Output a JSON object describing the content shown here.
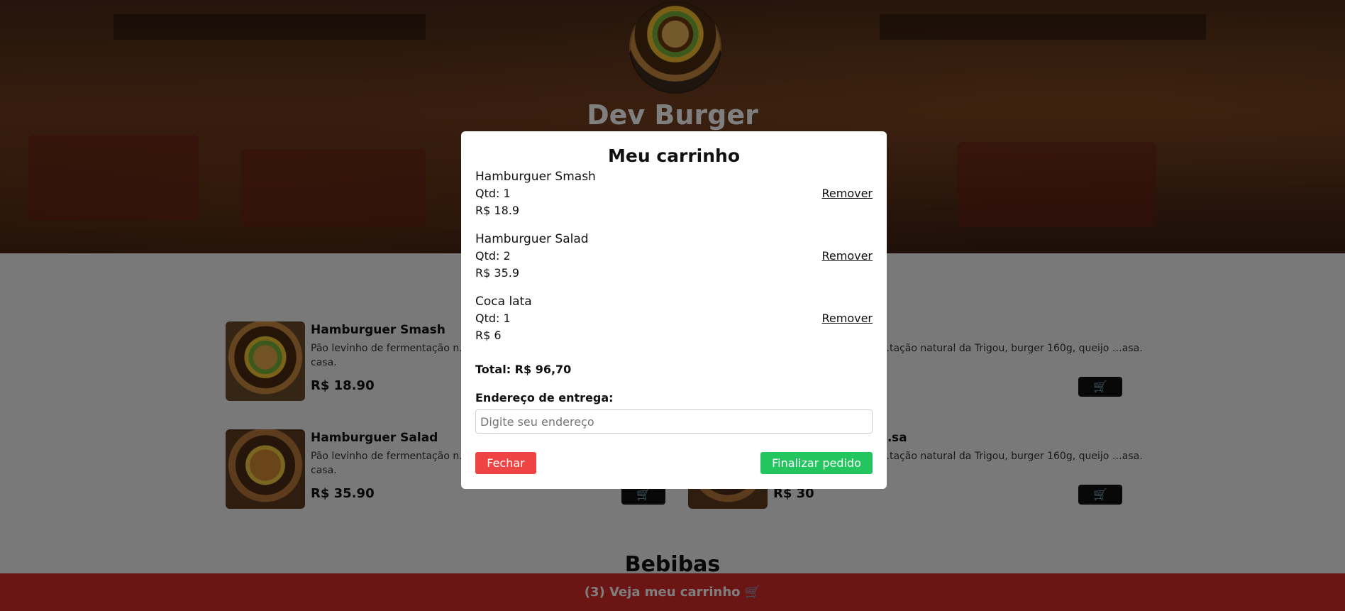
{
  "brand": {
    "name": "Dev Burger",
    "logo_icon": "burger-logo"
  },
  "menu": {
    "items": [
      {
        "name": "Hamburguer Smash",
        "description": "Pão levinho de fermentação n… prato e maionese da casa.",
        "price": "R$ 18.90",
        "cart_icon": "cart-icon"
      },
      {
        "name": "Hamburguer Salad",
        "description": "Pão levinho de fermentação n… prato e maionese da casa.",
        "price": "R$ 35.90",
        "cart_icon": "cart-icon"
      },
      {
        "name": "…sa",
        "description": "…tação natural da Trigou, burger 160g, queijo …asa.",
        "price": "R$ 30",
        "cart_icon": "cart-icon"
      },
      {
        "name": "",
        "description": "…tação natural da Trigou, burger 160g, queijo …asa.",
        "price": "",
        "cart_icon": "cart-icon"
      }
    ],
    "drinks_title": "Bebibas"
  },
  "footer": {
    "cart_label": "(3) Veja meu carrinho",
    "cart_icon": "cart-icon"
  },
  "modal": {
    "title": "Meu carrinho",
    "items": [
      {
        "name": "Hamburguer Smash",
        "qty": "Qtd: 1",
        "price": "R$ 18.9",
        "remove_label": "Remover"
      },
      {
        "name": "Hamburguer Salad",
        "qty": "Qtd: 2",
        "price": "R$ 35.9",
        "remove_label": "Remover"
      },
      {
        "name": "Coca lata",
        "qty": "Qtd: 1",
        "price": "R$ 6",
        "remove_label": "Remover"
      }
    ],
    "total": "Total: R$ 96,70",
    "address_label": "Endereço de entrega:",
    "address_placeholder": "Digite seu endereço",
    "address_value": "",
    "close_label": "Fechar",
    "finish_label": "Finalizar pedido"
  },
  "colors": {
    "accent_red": "#ef4444",
    "accent_green": "#22c55e",
    "footer_red": "#d92a2a"
  }
}
